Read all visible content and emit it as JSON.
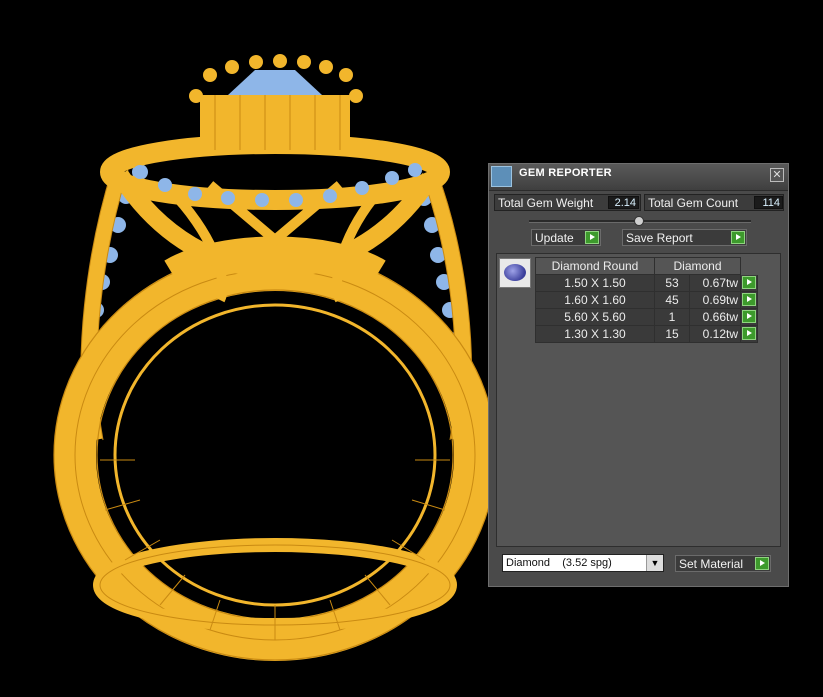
{
  "panel": {
    "title": "GEM REPORTER",
    "close_glyph": "✕",
    "total_gem_weight_label": "Total Gem Weight",
    "total_gem_weight_value": "2.14",
    "total_gem_count_label": "Total Gem Count",
    "total_gem_count_value": "114",
    "update_label": "Update",
    "save_report_label": "Save Report",
    "table": {
      "headers": [
        "Diamond Round",
        "Diamond"
      ],
      "rows": [
        {
          "size": "1.50 X 1.50",
          "count": "53",
          "tw": "0.67tw"
        },
        {
          "size": "1.60 X 1.60",
          "count": "45",
          "tw": "0.69tw"
        },
        {
          "size": "5.60 X 5.60",
          "count": "1",
          "tw": "0.66tw"
        },
        {
          "size": "1.30 X 1.30",
          "count": "15",
          "tw": "0.12tw"
        }
      ]
    },
    "material_select_value": "Diamond    (3.52 spg)",
    "set_material_label": "Set Material"
  },
  "viewport": {
    "model": "ring wireframe",
    "colors": {
      "metal": "#f2b62c",
      "metal_line": "#c98a12",
      "gem": "#8eb6e8"
    }
  }
}
